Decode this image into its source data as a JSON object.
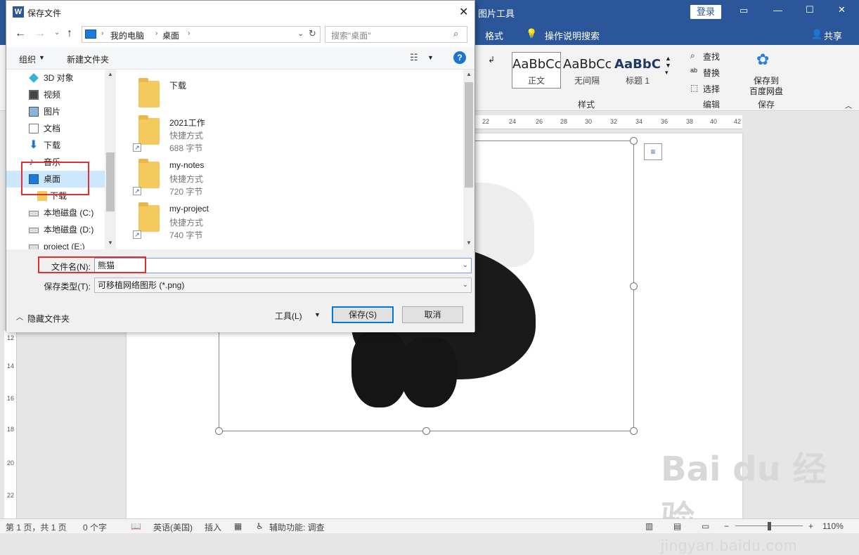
{
  "word": {
    "picture_tools_label": "图片工具",
    "login_label": "登录",
    "tabs": {
      "format": "格式",
      "tell_me": "操作说明搜索",
      "share": "共享"
    },
    "styles": [
      {
        "sample": "AaBbCcI",
        "label": "正文"
      },
      {
        "sample": "AaBbCcI",
        "label": "无间隔"
      },
      {
        "sample": "AaBbC",
        "label": "标题 1"
      }
    ],
    "groups": {
      "styles": "样式",
      "editing": "编辑",
      "save": "保存"
    },
    "editing": {
      "find": "查找",
      "replace": "替换",
      "select": "选择"
    },
    "baidu_save": {
      "line1": "保存到",
      "line2": "百度网盘"
    },
    "ruler_ticks": [
      "22",
      "24",
      "26",
      "28",
      "30",
      "32",
      "34",
      "36",
      "38",
      "40",
      "42"
    ],
    "vruler_ticks": [
      "12",
      "14",
      "16",
      "18",
      "20",
      "22"
    ],
    "status": {
      "page": "第 1 页，共 1 页",
      "words": "0 个字",
      "language": "英语(美国)",
      "insert": "插入",
      "accessibility": "辅助功能: 调查",
      "zoom": "110%"
    },
    "watermark": {
      "brand": "Bai du 经验",
      "url": "jingyan.baidu.com"
    }
  },
  "dialog": {
    "title": "保存文件",
    "breadcrumb": [
      "我的电脑",
      "桌面"
    ],
    "search_placeholder": "搜索\"桌面\"",
    "organize": "组织",
    "new_folder": "新建文件夹",
    "nav_items": [
      {
        "label": "3D 对象",
        "icon": "cube-icon"
      },
      {
        "label": "视频",
        "icon": "video-icon"
      },
      {
        "label": "图片",
        "icon": "picture-icon"
      },
      {
        "label": "文档",
        "icon": "document-icon"
      },
      {
        "label": "下载",
        "icon": "download-icon"
      },
      {
        "label": "音乐",
        "icon": "music-icon"
      },
      {
        "label": "桌面",
        "icon": "desktop-icon",
        "selected": true
      },
      {
        "label": "下载",
        "icon": "folder-icon"
      },
      {
        "label": "本地磁盘 (C:)",
        "icon": "drive-icon"
      },
      {
        "label": "本地磁盘 (D:)",
        "icon": "drive-icon"
      },
      {
        "label": "project (E:)",
        "icon": "drive-icon"
      }
    ],
    "files": [
      {
        "name": "下载",
        "type": "",
        "size": ""
      },
      {
        "name": "2021工作",
        "type": "快捷方式",
        "size": "688 字节"
      },
      {
        "name": "my-notes",
        "type": "快捷方式",
        "size": "720 字节"
      },
      {
        "name": "my-project",
        "type": "快捷方式",
        "size": "740 字节"
      }
    ],
    "filename_label": "文件名(N):",
    "filename_value": "熊猫",
    "filetype_label": "保存类型(T):",
    "filetype_value": "可移植网络图形 (*.png)",
    "hide_folders": "隐藏文件夹",
    "tools": "工具(L)",
    "save": "保存(S)",
    "cancel": "取消"
  },
  "colors": {
    "word_blue": "#2b579a",
    "selection": "#cce8ff",
    "highlight_red": "#e0312e"
  }
}
